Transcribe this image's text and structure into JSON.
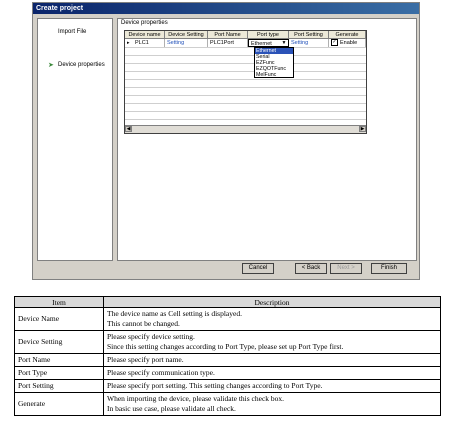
{
  "dialog": {
    "title": "Create project",
    "nav": [
      {
        "label": "Import File"
      },
      {
        "label": "Device properties"
      }
    ],
    "section_label": "Device properties",
    "columns": [
      "Device name",
      "Device Setting",
      "Port Name",
      "Port type",
      "Port Setting",
      "Generate"
    ],
    "row": {
      "device_name": "PLC1",
      "device_setting": "Setting",
      "port_name": "PLC1Port",
      "port_type": "Ethernet",
      "port_setting": "Setting",
      "generate": "Enable",
      "generate_checked": true
    },
    "port_type_options": [
      "Ethernet",
      "Serial",
      "EZFunc",
      "EZQOTFunc",
      "MelFunc"
    ],
    "buttons": {
      "cancel": "Cancel",
      "back": "< Back",
      "next": "Next >",
      "finish": "Finish"
    }
  },
  "table": {
    "headers": [
      "Item",
      "Description"
    ],
    "rows": [
      {
        "item": "Device Name",
        "lines": [
          "The device name as Cell setting is displayed.",
          "This cannot be changed."
        ]
      },
      {
        "item": "Device Setting",
        "lines": [
          "Please specify device setting.",
          "Since this setting changes according to Port Type, please set up Port Type first."
        ]
      },
      {
        "item": "Port Name",
        "lines": [
          "Please specify port name."
        ]
      },
      {
        "item": "Port Type",
        "lines": [
          "Please specify communication type."
        ]
      },
      {
        "item": "Port Setting",
        "lines": [
          "Please specify port setting. This setting changes according to Port Type."
        ]
      },
      {
        "item": "Generate",
        "lines": [
          "When importing the device, please validate this check box.",
          "In basic use case, please validate all check."
        ]
      }
    ]
  }
}
